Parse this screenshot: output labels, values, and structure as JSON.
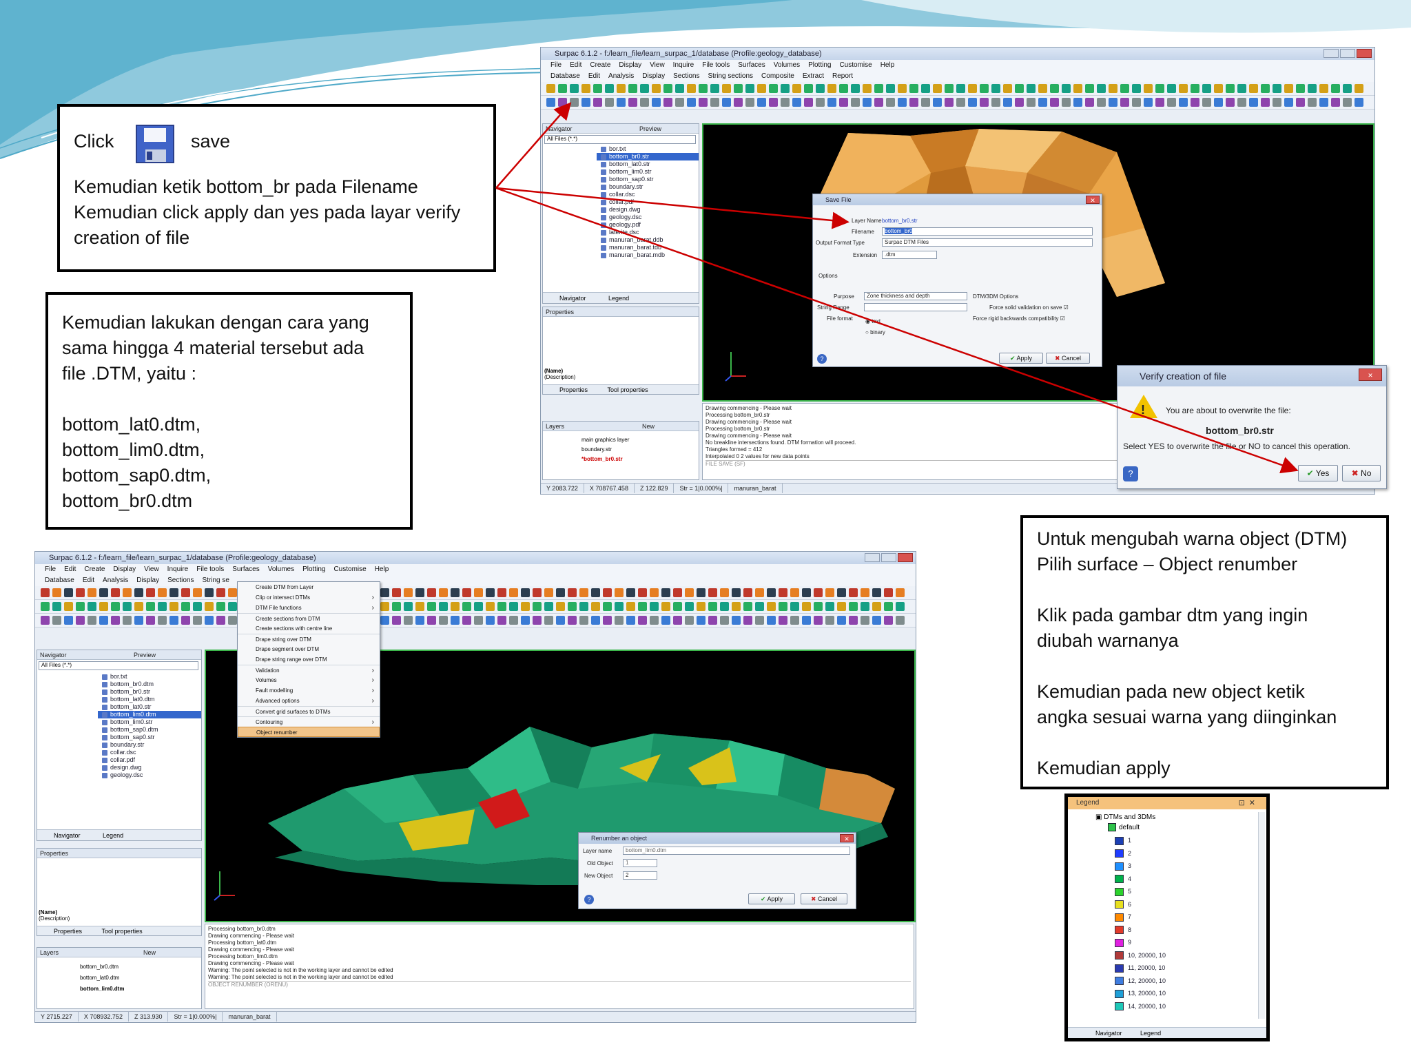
{
  "instructions": {
    "save_box": {
      "click_label": "Click",
      "save_label": "save",
      "text": "Kemudian ketik bottom_br pada Filename\nKemudian click apply dan yes pada layar verify\ncreation of file"
    },
    "repeat_box": {
      "text": "Kemudian lakukan dengan cara yang\nsama hingga 4 material tersebut ada\nfile .DTM, yaitu :",
      "files": [
        "bottom_lat0.dtm,",
        "bottom_lim0.dtm,",
        "bottom_sap0.dtm,",
        "bottom_br0.dtm"
      ]
    },
    "color_box": {
      "line1": "Untuk mengubah warna object (DTM)",
      "line2": "Pilih surface – Object renumber",
      "line3": "Klik pada gambar dtm yang ingin\ndiubah warnanya",
      "line4": "Kemudian pada new object ketik\nangka sesuai warna yang diinginkan",
      "line5": "Kemudian apply"
    }
  },
  "window_top": {
    "title": "Surpac 6.1.2 - f:/learn_file/learn_surpac_1/database (Profile:geology_database)",
    "menus": [
      "File",
      "Edit",
      "Create",
      "Display",
      "View",
      "Inquire",
      "File tools",
      "Surfaces",
      "Volumes",
      "Plotting",
      "Customise",
      "Help"
    ],
    "menus2": [
      "Database",
      "Edit",
      "Analysis",
      "Display",
      "Sections",
      "String sections",
      "Composite",
      "Extract",
      "Report"
    ],
    "navigator_label": "Navigator",
    "preview_label": "Preview",
    "filter": "All Files (*.*)",
    "files": [
      "bor.txt",
      "bottom_br0.str",
      "bottom_lat0.str",
      "bottom_lim0.str",
      "bottom_sap0.str",
      "boundary.str",
      "collar.dsc",
      "collar.pdf",
      "design.dwg",
      "geology.dsc",
      "geology.pdf",
      "laterite.dsc",
      "manuran_barat.ddb",
      "manuran_barat.tdb",
      "manuran_barat.mdb"
    ],
    "selected_file_index": 1,
    "tabs": [
      "Navigator",
      "Legend"
    ],
    "properties_label": "Properties",
    "prop_name": "(Name)",
    "prop_desc": "(Description)",
    "prop_tabs": [
      "Properties",
      "Tool properties"
    ],
    "layers_label": "Layers",
    "layers_new": "New",
    "layers": [
      "main graphics layer",
      "boundary.str",
      "*bottom_br0.str"
    ],
    "log": [
      "Drawing commencing - Please wait",
      "Processing bottom_br0.str",
      "Drawing commencing - Please wait",
      "Processing bottom_br0.str",
      "Drawing commencing - Please wait",
      "No breakline intersections found. DTM formation will proceed.",
      "Triangles formed = 412",
      "Interpolated 0     2 values for new data points"
    ],
    "log_prompt": "FILE SAVE (SF)",
    "status": [
      "Y 2083.722",
      "X 708767.458",
      "Z 122.829",
      "Str = 1|0.000%|",
      "manuran_barat"
    ]
  },
  "save_dialog": {
    "title": "Save File",
    "layer_name_label": "Layer Name",
    "layer_name": "bottom_br0.str",
    "filename_label": "Filename",
    "filename": "bottom_br0",
    "format_label": "Output Format Type",
    "format": "Surpac DTM Files",
    "extension_label": "Extension",
    "extension": ".dtm",
    "options_label": "Options",
    "purpose_label": "Purpose",
    "purpose": "Zone thickness and depth",
    "string_range_label": "String Range",
    "file_format_label": "File format",
    "file_format_text": "text",
    "file_format_binary": "binary",
    "dtm_options_label": "DTM/3DM Options",
    "opt1": "Force solid validation on save",
    "opt2": "Force rigid backwards compatibility",
    "apply": "Apply",
    "cancel": "Cancel"
  },
  "verify_dialog": {
    "title": "Verify creation of file",
    "message": "You are about to overwrite the file:",
    "filename": "bottom_br0.str",
    "prompt": "Select YES to overwrite the file or NO to cancel this operation.",
    "yes": "Yes",
    "no": "No"
  },
  "window_bottom": {
    "title": "Surpac 6.1.2 - f:/learn_file/learn_surpac_1/database (Profile:geology_database)",
    "menus": [
      "File",
      "Edit",
      "Create",
      "Display",
      "View",
      "Inquire",
      "File tools",
      "Surfaces",
      "Volumes",
      "Plotting",
      "Customise",
      "Help"
    ],
    "menus2": [
      "Database",
      "Edit",
      "Analysis",
      "Display",
      "Sections",
      "String se"
    ],
    "navigator_label": "Navigator",
    "preview_label": "Preview",
    "filter": "All Files (*.*)",
    "files": [
      "bor.txt",
      "bottom_br0.dtm",
      "bottom_br0.str",
      "bottom_lat0.dtm",
      "bottom_lat0.str",
      "bottom_lim0.dtm",
      "bottom_lim0.str",
      "bottom_sap0.dtm",
      "bottom_sap0.str",
      "boundary.str",
      "collar.dsc",
      "collar.pdf",
      "design.dwg",
      "geology.dsc"
    ],
    "selected_file_index": 5,
    "tabs": [
      "Navigator",
      "Legend"
    ],
    "properties_label": "Properties",
    "prop_name": "(Name)",
    "prop_desc": "(Description)",
    "prop_tabs": [
      "Properties",
      "Tool properties"
    ],
    "layers_label": "Layers",
    "layers_new": "New",
    "layers": [
      "bottom_br0.dtm",
      "bottom_lat0.dtm",
      "bottom_lim0.dtm"
    ],
    "log": [
      "Processing bottom_br0.dtm",
      "Drawing commencing - Please wait",
      "Processing bottom_lat0.dtm",
      "Drawing commencing - Please wait",
      "Processing bottom_lim0.dtm",
      "Drawing commencing - Please wait",
      "Warning: The point selected is not in the working layer and cannot be edited",
      "Warning: The point selected is not in the working layer and cannot be edited"
    ],
    "log_prompt": "OBJECT RENUMBER (ORENU)",
    "status": [
      "Y 2715.227",
      "X 708932.752",
      "Z 313.930",
      "Str = 1|0.000%|",
      "manuran_barat"
    ]
  },
  "surfaces_menu": {
    "items": [
      "Create DTM from Layer",
      "Clip or intersect DTMs",
      "DTM File functions",
      "Create sections from DTM",
      "Create sections with centre line",
      "Drape string over DTM",
      "Drape segment over DTM",
      "Drape string range over DTM",
      "Validation",
      "Volumes",
      "Fault modelling",
      "Advanced options",
      "Convert grid surfaces to DTMs",
      "Contouring",
      "Object renumber"
    ],
    "active_index": 14
  },
  "renumber_dialog": {
    "title": "Renumber an object",
    "layer_name_label": "Layer name",
    "layer_name": "bottom_lim0.dtm",
    "old_object_label": "Old Object",
    "old_object": "1",
    "new_object_label": "New Object",
    "new_object": "2",
    "apply": "Apply",
    "cancel": "Cancel"
  },
  "legend": {
    "title": "Legend",
    "root": "DTMs and 3DMs",
    "default": "default",
    "entries": [
      {
        "label": "1",
        "color": "#1c3fb5"
      },
      {
        "label": "2",
        "color": "#1e3cff"
      },
      {
        "label": "3",
        "color": "#1e90ff"
      },
      {
        "label": "4",
        "color": "#00b24a"
      },
      {
        "label": "5",
        "color": "#2dd32d"
      },
      {
        "label": "6",
        "color": "#e8e020"
      },
      {
        "label": "7",
        "color": "#ff8a00"
      },
      {
        "label": "8",
        "color": "#e23a2a"
      },
      {
        "label": "9",
        "color": "#e020e0"
      },
      {
        "label": "10, 20000, 10",
        "color": "#b03a3a"
      },
      {
        "label": "11, 20000, 10",
        "color": "#2a3ab0"
      },
      {
        "label": "12, 20000, 10",
        "color": "#3e7de0"
      },
      {
        "label": "13, 20000, 10",
        "color": "#1ea0d8"
      },
      {
        "label": "14, 20000, 10",
        "color": "#1ec8b8"
      }
    ],
    "tabs": [
      "Navigator",
      "Legend"
    ]
  },
  "colors": {
    "callout_arrow": "#cc0000",
    "viewport_border": "#3bb54a",
    "dtm_orange": "#e09a3c",
    "dtm_green": "#1f9a6e",
    "dtm_red": "#d11a1a",
    "dtm_yellow": "#d9c21a"
  }
}
